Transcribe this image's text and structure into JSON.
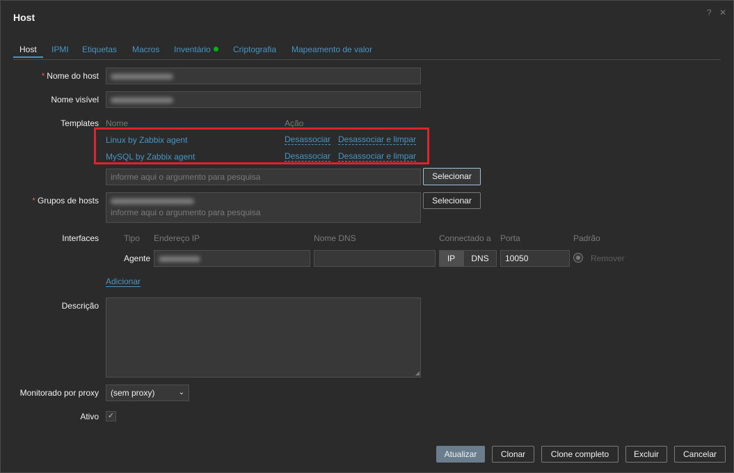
{
  "dialog": {
    "title": "Host",
    "help_icon": "?",
    "close_icon": "✕"
  },
  "tabs": [
    {
      "label": "Host"
    },
    {
      "label": "IPMI"
    },
    {
      "label": "Etiquetas"
    },
    {
      "label": "Macros"
    },
    {
      "label": "Inventário"
    },
    {
      "label": "Criptografia"
    },
    {
      "label": "Mapeamento de valor"
    }
  ],
  "form": {
    "host_name_label": "Nome do host",
    "visible_name_label": "Nome visível",
    "templates_label": "Templates",
    "templates_header_name": "Nome",
    "templates_header_action": "Ação",
    "templates": [
      {
        "name": "Linux by Zabbix agent",
        "unlink": "Desassociar",
        "unlink_clear": "Desassociar e limpar"
      },
      {
        "name": "MySQL by Zabbix agent",
        "unlink": "Desassociar",
        "unlink_clear": "Desassociar e limpar"
      }
    ],
    "template_search_placeholder": "informe aqui o argumento para pesquisa",
    "select_button": "Selecionar",
    "host_groups_label": "Grupos de hosts",
    "host_groups_placeholder": "informe aqui o argumento para pesquisa",
    "interfaces_label": "Interfaces",
    "interfaces_headers": {
      "type": "Tipo",
      "ip": "Endereço IP",
      "dns": "Nome DNS",
      "connect_to": "Connectado a",
      "port": "Porta",
      "default": "Padrão"
    },
    "interface_row": {
      "type": "Agente",
      "connect_ip": "IP",
      "connect_dns": "DNS",
      "port": "10050",
      "remove": "Remover"
    },
    "add_link": "Adicionar",
    "description_label": "Descrição",
    "proxy_label": "Monitorado por proxy",
    "proxy_value": "(sem proxy)",
    "enabled_label": "Ativo"
  },
  "footer": {
    "update": "Atualizar",
    "clone": "Clonar",
    "full_clone": "Clone completo",
    "delete": "Excluir",
    "cancel": "Cancelar"
  },
  "colors": {
    "link": "#4796c4",
    "highlight": "#e3202e",
    "status_dot": "#00b215",
    "required": "#e45959"
  }
}
